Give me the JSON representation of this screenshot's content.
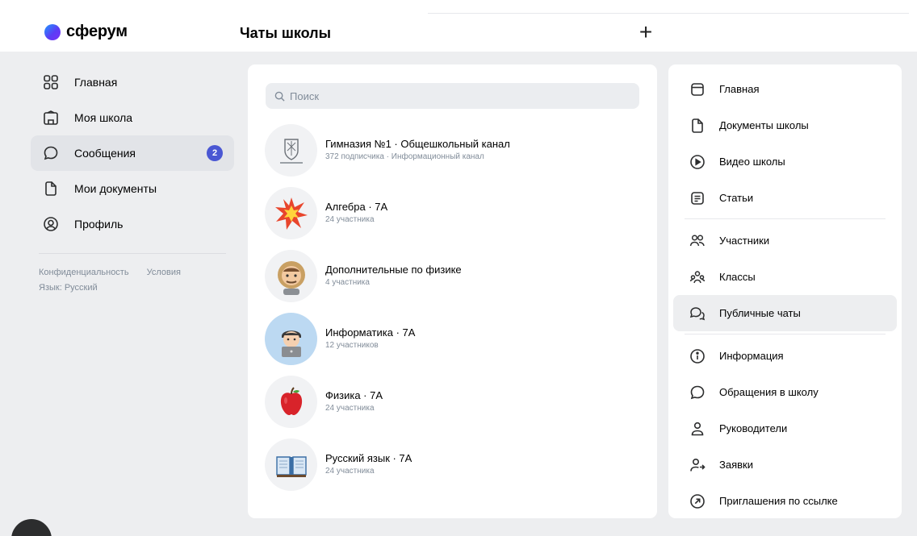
{
  "header": {
    "logo_text": "сферум",
    "title": "Чаты школы",
    "add_label": "+"
  },
  "nav": {
    "items": [
      {
        "label": "Главная",
        "icon": "grid-icon"
      },
      {
        "label": "Моя школа",
        "icon": "school-icon"
      },
      {
        "label": "Сообщения",
        "icon": "message-icon",
        "badge": "2"
      },
      {
        "label": "Мои документы",
        "icon": "document-icon"
      },
      {
        "label": "Профиль",
        "icon": "profile-icon"
      }
    ],
    "legal": {
      "privacy": "Конфиденциальность",
      "terms": "Условия",
      "language": "Язык: Русский"
    }
  },
  "search": {
    "placeholder": "Поиск"
  },
  "chats": [
    {
      "name": "Гимназия №1 · Общешкольный канал",
      "sub": "372 подписчика · Информационный канал",
      "icon": "school-crest-icon"
    },
    {
      "name": "Алгебра · 7А",
      "sub": "24 участника",
      "icon": "explosion-icon"
    },
    {
      "name": "Дополнительные по физике",
      "sub": "4 участника",
      "icon": "astronaut-icon"
    },
    {
      "name": "Информатика · 7А",
      "sub": "12 участников",
      "icon": "technologist-icon"
    },
    {
      "name": "Физика · 7А",
      "sub": "24 участника",
      "icon": "apple-icon"
    },
    {
      "name": "Русский язык · 7А",
      "sub": "24 участника",
      "icon": "open-book-icon"
    }
  ],
  "menu": {
    "group1": [
      {
        "label": "Главная",
        "icon": "home-icon"
      },
      {
        "label": "Документы школы",
        "icon": "document-icon"
      },
      {
        "label": "Видео школы",
        "icon": "play-icon"
      },
      {
        "label": "Статьи",
        "icon": "article-icon"
      }
    ],
    "group2": [
      {
        "label": "Участники",
        "icon": "users-icon"
      },
      {
        "label": "Классы",
        "icon": "group-icon"
      },
      {
        "label": "Публичные чаты",
        "icon": "chats-icon"
      }
    ],
    "group3": [
      {
        "label": "Информация",
        "icon": "info-icon"
      },
      {
        "label": "Обращения в школу",
        "icon": "message-icon"
      },
      {
        "label": "Руководители",
        "icon": "user-icon"
      },
      {
        "label": "Заявки",
        "icon": "user-add-icon"
      },
      {
        "label": "Приглашения по ссылке",
        "icon": "link-arrow-icon"
      }
    ]
  },
  "colors": {
    "accent": "#4a57d3",
    "background": "#edeef0",
    "secondary_text": "#818c99"
  }
}
